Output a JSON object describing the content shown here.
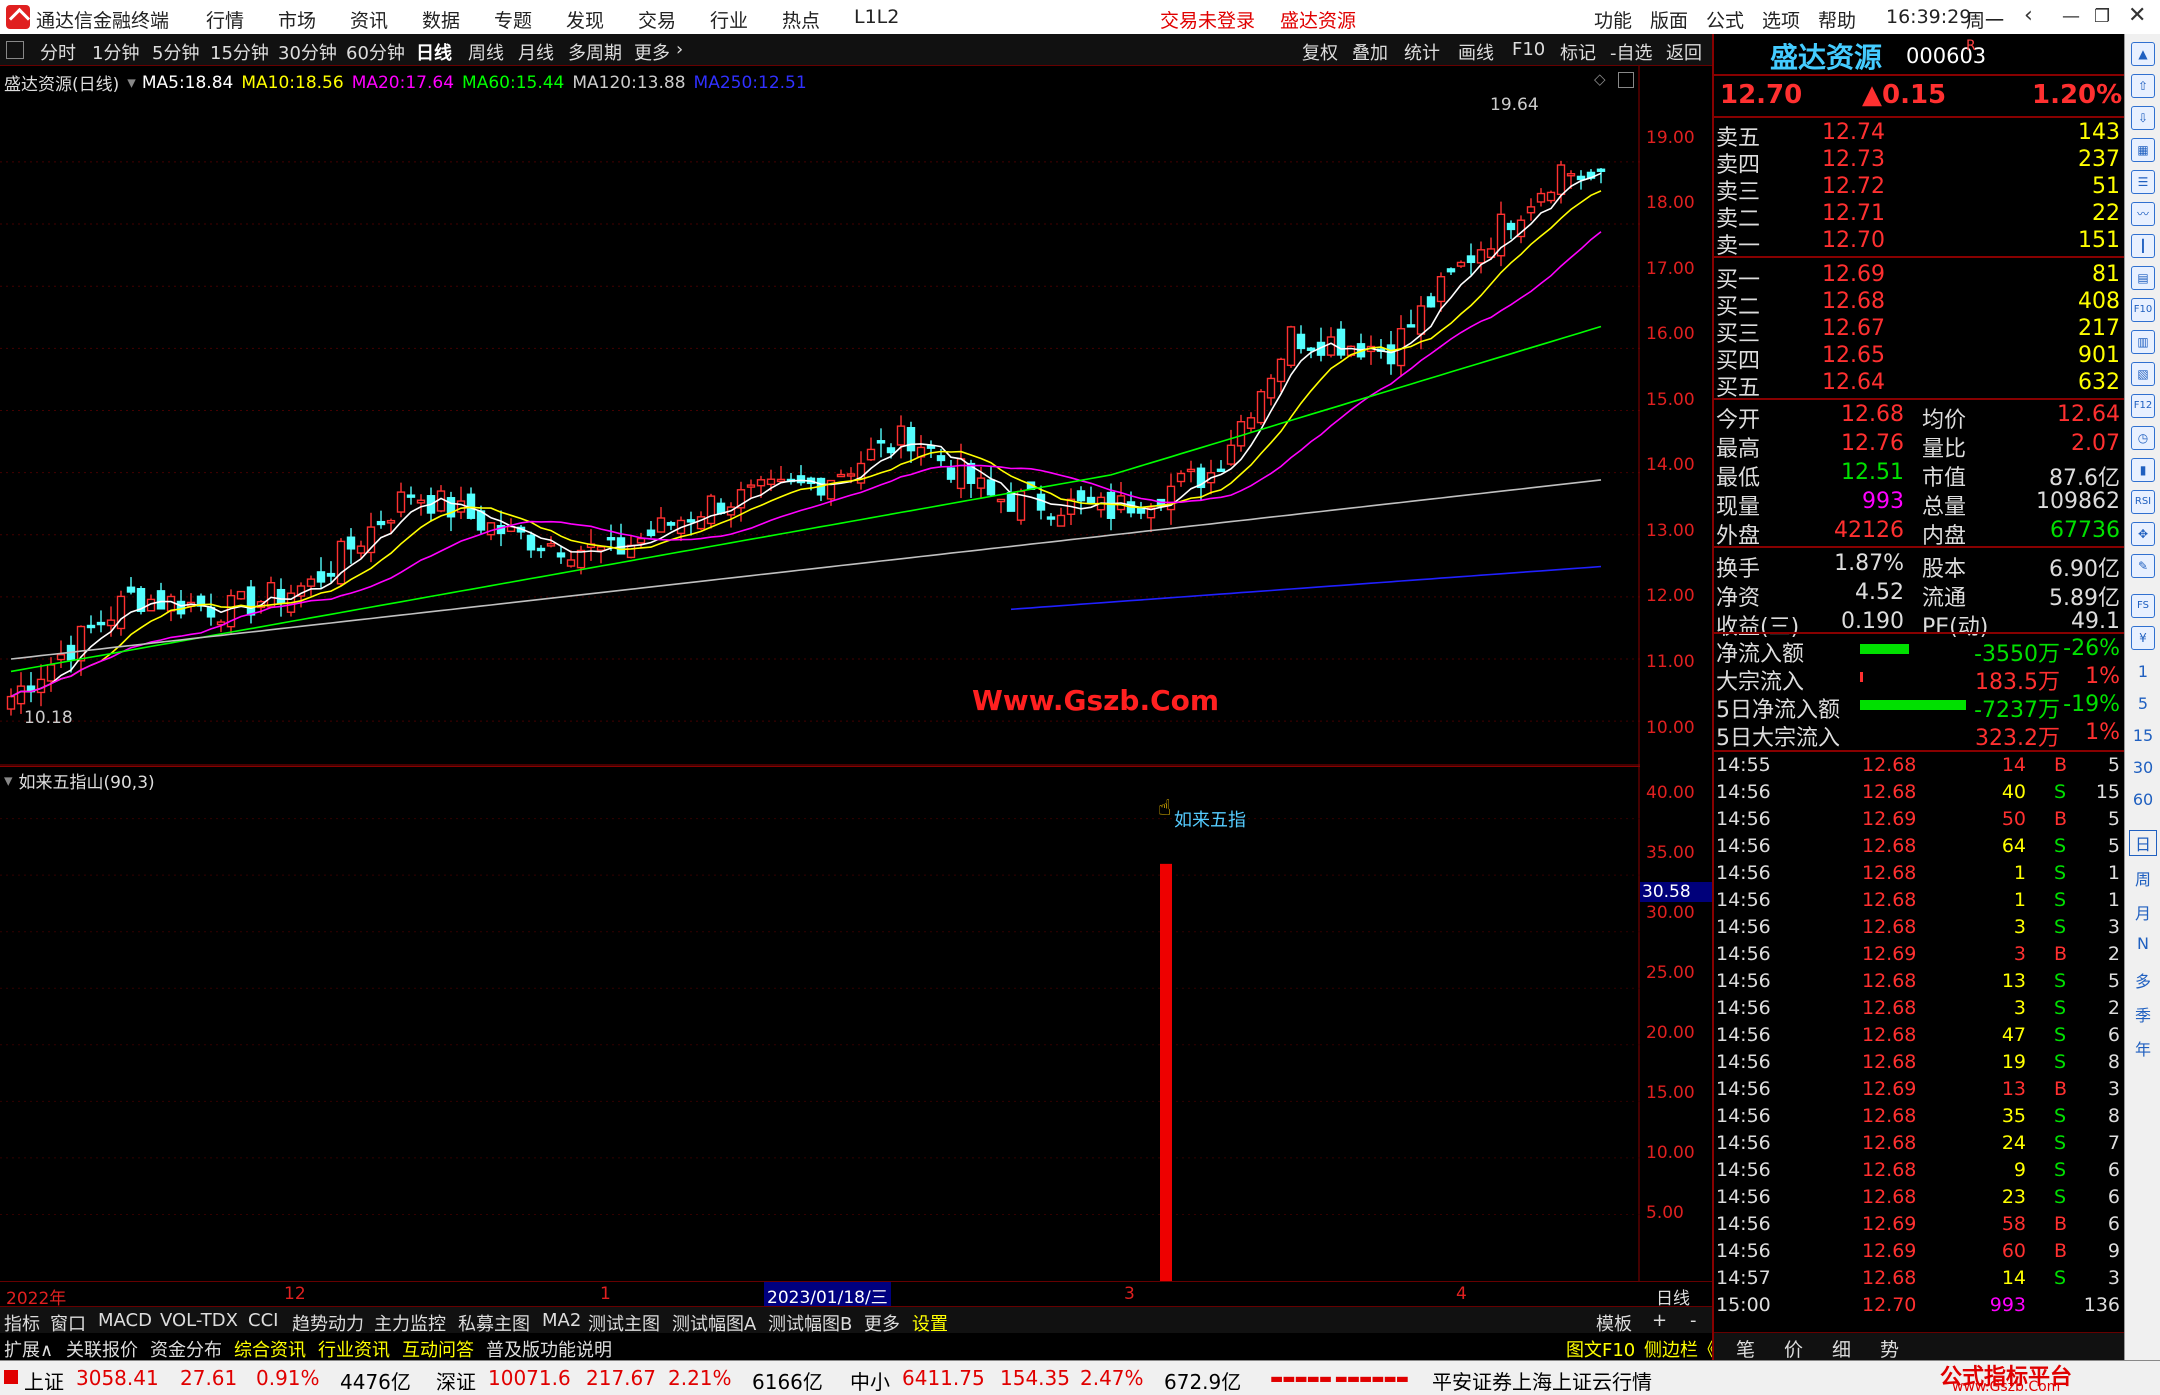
{
  "title_bar": {
    "app_name": "通达信金融终端",
    "menus": [
      "行情",
      "市场",
      "资讯",
      "数据",
      "专题",
      "发现",
      "交易",
      "行业",
      "热点",
      "L1L2"
    ],
    "login_status": "交易未登录",
    "stock_name": "盛达资源",
    "right_menus": [
      "功能",
      "版面",
      "公式",
      "选项",
      "帮助"
    ],
    "time": "16:39:29",
    "weekday": "周一"
  },
  "period_bar": {
    "periods": [
      "分时",
      "1分钟",
      "5分钟",
      "15分钟",
      "30分钟",
      "60分钟",
      "日线",
      "周线",
      "月线",
      "多周期",
      "更多"
    ],
    "selected": "日线",
    "right_buttons": [
      "复权",
      "叠加",
      "统计",
      "画线",
      "F10",
      "标记",
      "-自选",
      "返回"
    ]
  },
  "main_chart": {
    "label": "盛达资源(日线)",
    "ma": [
      {
        "name": "MA5",
        "value": "18.84",
        "color": "#ffffff"
      },
      {
        "name": "MA10",
        "value": "18.56",
        "color": "#ffff00"
      },
      {
        "name": "MA20",
        "value": "17.64",
        "color": "#ff00ff"
      },
      {
        "name": "MA60",
        "value": "15.44",
        "color": "#00ff00"
      },
      {
        "name": "MA120",
        "value": "13.88",
        "color": "#c0c0c0"
      },
      {
        "name": "MA250",
        "value": "12.51",
        "color": "#2020ff"
      }
    ],
    "high_label": "19.64",
    "low_label": "10.18",
    "watermark": "Www.Gszb.Com",
    "y_ticks": [
      "19.00",
      "18.00",
      "17.00",
      "16.00",
      "15.00",
      "14.00",
      "13.00",
      "12.00",
      "11.00",
      "10.00"
    ]
  },
  "sub_chart": {
    "label": "如来五指山(90,3)",
    "signal_label": "如来五指",
    "current_value": "30.58",
    "y_ticks": [
      "40.00",
      "35.00",
      "30.00",
      "25.00",
      "20.00",
      "15.00",
      "10.00",
      "5.00"
    ],
    "x_labels": [
      "2022年",
      "12",
      "1",
      "2023/01/18/三",
      "3",
      "4"
    ],
    "period": "日线"
  },
  "chart_data": {
    "type": "bar",
    "title": "如来五指山(90,3)",
    "signal": {
      "label": "如来五指",
      "value": 36
    },
    "current_value": 30.58,
    "ylim": [
      0,
      42
    ],
    "x_labels": [
      "2022年",
      "12",
      "1",
      "2023/01/18/三",
      "3",
      "4"
    ]
  },
  "quote": {
    "name": "盛达资源",
    "code": "000603",
    "price": "12.70",
    "change": "▲0.15",
    "pct": "1.20%",
    "asks": [
      {
        "label": "卖五",
        "price": "12.74",
        "vol": "143"
      },
      {
        "label": "卖四",
        "price": "12.73",
        "vol": "237"
      },
      {
        "label": "卖三",
        "price": "12.72",
        "vol": "51"
      },
      {
        "label": "卖二",
        "price": "12.71",
        "vol": "22"
      },
      {
        "label": "卖一",
        "price": "12.70",
        "vol": "151"
      }
    ],
    "bids": [
      {
        "label": "买一",
        "price": "12.69",
        "vol": "81"
      },
      {
        "label": "买二",
        "price": "12.68",
        "vol": "408"
      },
      {
        "label": "买三",
        "price": "12.67",
        "vol": "217"
      },
      {
        "label": "买四",
        "price": "12.65",
        "vol": "901"
      },
      {
        "label": "买五",
        "price": "12.64",
        "vol": "632"
      }
    ],
    "stats": [
      [
        "今开",
        "12.68",
        "均价",
        "12.64"
      ],
      [
        "最高",
        "12.76",
        "量比",
        "2.07"
      ],
      [
        "最低",
        "12.51",
        "市值",
        "87.6亿"
      ],
      [
        "现量",
        "993",
        "总量",
        "109862"
      ],
      [
        "外盘",
        "42126",
        "内盘",
        "67736"
      ],
      [
        "换手",
        "1.87%",
        "股本",
        "6.90亿"
      ],
      [
        "净资",
        "4.52",
        "流通",
        "5.89亿"
      ],
      [
        "收益(三)",
        "0.190",
        "PE(动)",
        "49.1"
      ]
    ],
    "flows": [
      {
        "label": "净流入额",
        "value": "-3550万",
        "pct": "-26%",
        "bar": 0.26
      },
      {
        "label": "大宗流入",
        "value": "183.5万",
        "pct": "1%",
        "bar": 0.01
      },
      {
        "label": "5日净流入额",
        "value": "-7237万",
        "pct": "-19%",
        "bar": 0.56
      },
      {
        "label": "5日大宗流入",
        "value": "323.2万",
        "pct": "1%",
        "bar": 0
      }
    ],
    "ticks": [
      [
        "14:55",
        "12.68",
        "14",
        "B",
        "5"
      ],
      [
        "14:56",
        "12.68",
        "40",
        "S",
        "15"
      ],
      [
        "14:56",
        "12.69",
        "50",
        "B",
        "5"
      ],
      [
        "14:56",
        "12.68",
        "64",
        "S",
        "5"
      ],
      [
        "14:56",
        "12.68",
        "1",
        "S",
        "1"
      ],
      [
        "14:56",
        "12.68",
        "1",
        "S",
        "1"
      ],
      [
        "14:56",
        "12.68",
        "3",
        "S",
        "3"
      ],
      [
        "14:56",
        "12.69",
        "3",
        "B",
        "2"
      ],
      [
        "14:56",
        "12.68",
        "13",
        "S",
        "5"
      ],
      [
        "14:56",
        "12.68",
        "3",
        "S",
        "2"
      ],
      [
        "14:56",
        "12.68",
        "47",
        "S",
        "6"
      ],
      [
        "14:56",
        "12.68",
        "19",
        "S",
        "8"
      ],
      [
        "14:56",
        "12.69",
        "13",
        "B",
        "3"
      ],
      [
        "14:56",
        "12.68",
        "35",
        "S",
        "8"
      ],
      [
        "14:56",
        "12.68",
        "24",
        "S",
        "7"
      ],
      [
        "14:56",
        "12.68",
        "9",
        "S",
        "6"
      ],
      [
        "14:56",
        "12.68",
        "23",
        "S",
        "6"
      ],
      [
        "14:56",
        "12.69",
        "58",
        "B",
        "6"
      ],
      [
        "14:56",
        "12.69",
        "60",
        "B",
        "9"
      ],
      [
        "14:57",
        "12.68",
        "14",
        "S",
        "3"
      ],
      [
        "15:00",
        "12.70",
        "993",
        "",
        "136"
      ]
    ],
    "tabs": [
      "笔",
      "价",
      "细",
      "势"
    ]
  },
  "bottom1": [
    "指标",
    "窗口",
    "MACD",
    "VOL-TDX",
    "CCI",
    "趋势动力",
    "主力监控",
    "私募主图",
    "MA2",
    "测试主图",
    "测试幅图A",
    "测试幅图B",
    "更多",
    "设置"
  ],
  "bottom1_right": [
    "模板",
    "+",
    "-"
  ],
  "bottom2": [
    "扩展∧",
    "关联报价",
    "资金分布",
    "综合资讯",
    "行业资讯",
    "互动问答",
    "普及版功能说明"
  ],
  "bottom2_right": [
    "图文F10",
    "侧边栏《"
  ],
  "status": {
    "sh_label": "上证",
    "sh": "3058.41",
    "sh_chg": "27.61",
    "sh_pct": "0.91%",
    "sh_amt": "4476亿",
    "sz_label": "深证",
    "sz": "10071.6",
    "sz_chg": "217.67",
    "sz_pct": "2.21%",
    "sz_amt": "6166亿",
    "zx_label": "中小",
    "zx": "6411.75",
    "zx_chg": "154.35",
    "zx_pct": "2.47%",
    "zx_amt": "672.9亿",
    "broker": "平安证券上海上证云行情",
    "brand": "公式指标平台",
    "brand_url": "www.Gszb.Com"
  },
  "toolstrip": [
    "RSI",
    "FS",
    "F10",
    "1",
    "5",
    "15",
    "30",
    "60",
    "日",
    "周",
    "月",
    "N",
    "多",
    "季",
    "年"
  ]
}
